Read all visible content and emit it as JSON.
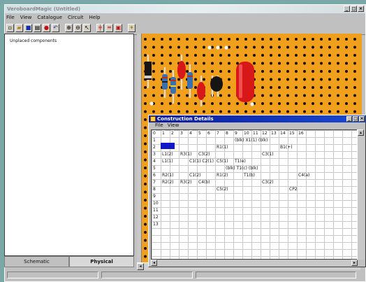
{
  "window": {
    "title": "VeroboardMagic (Untitled)"
  },
  "menu": [
    "File",
    "View",
    "Catalogue",
    "Circuit",
    "Help"
  ],
  "left_panel": {
    "heading": "Unplaced components",
    "tabs": [
      "Schematic",
      "Physical"
    ],
    "active_tab": "Physical"
  },
  "board": {
    "color": "#f0a01c"
  },
  "dialog": {
    "title": "Construction Details",
    "menu": [
      "File",
      "View"
    ],
    "columns": [
      "0",
      "1",
      "2",
      "3",
      "4",
      "5",
      "6",
      "7",
      "8",
      "9",
      "10",
      "11",
      "12",
      "13",
      "14",
      "15",
      "16"
    ],
    "rows": [
      "1",
      "2",
      "3",
      "4",
      "5",
      "6",
      "7",
      "8",
      "9",
      "10",
      "11",
      "12",
      "13"
    ],
    "cells": [
      {
        "row": 1,
        "col": 9,
        "text": "(blk) X1(1) (blk)"
      },
      {
        "row": 2,
        "col": 7,
        "text": "R1(1)"
      },
      {
        "row": 2,
        "col": 14,
        "text": "B1(+)"
      },
      {
        "row": 3,
        "col": 1,
        "text": "L1(2)"
      },
      {
        "row": 3,
        "col": 3,
        "text": "R3(1)"
      },
      {
        "row": 3,
        "col": 5,
        "text": "C3(2)"
      },
      {
        "row": 3,
        "col": 12,
        "text": "C3(1)"
      },
      {
        "row": 4,
        "col": 1,
        "text": "L1(1)"
      },
      {
        "row": 4,
        "col": 4,
        "text": "C1(1) C2(1)"
      },
      {
        "row": 4,
        "col": 7,
        "text": "C5(1)"
      },
      {
        "row": 4,
        "col": 9,
        "text": "T1(e)"
      },
      {
        "row": 5,
        "col": 8,
        "text": "(blk) T1(c) (blk)"
      },
      {
        "row": 6,
        "col": 1,
        "text": "R2(1)"
      },
      {
        "row": 6,
        "col": 4,
        "text": "C1(2)"
      },
      {
        "row": 6,
        "col": 7,
        "text": "R1(2)"
      },
      {
        "row": 6,
        "col": 10,
        "text": "T1(b)"
      },
      {
        "row": 6,
        "col": 16,
        "text": "C4(a)"
      },
      {
        "row": 7,
        "col": 1,
        "text": "R2(2)"
      },
      {
        "row": 7,
        "col": 3,
        "text": "R3(2)"
      },
      {
        "row": 7,
        "col": 5,
        "text": "C4(b)"
      },
      {
        "row": 7,
        "col": 12,
        "text": "C3(2)"
      },
      {
        "row": 8,
        "col": 7,
        "text": "C5(2)"
      },
      {
        "row": 8,
        "col": 15,
        "text": "CP2"
      }
    ]
  }
}
